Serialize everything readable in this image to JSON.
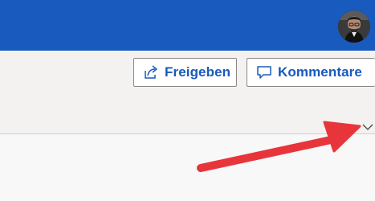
{
  "titlebar": {
    "color": "#185abd"
  },
  "user": {
    "avatar_icon": "user-avatar-photo"
  },
  "toolbar": {
    "share_label": "Freigeben",
    "share_icon": "share-icon",
    "comment_label": "Kommentare",
    "comment_icon": "comment-icon",
    "accent_color": "#185abd",
    "expand_icon": "chevron-down-icon"
  },
  "annotation": {
    "arrow_color": "#e8353c",
    "arrow_icon": "red-arrow-annotation"
  }
}
